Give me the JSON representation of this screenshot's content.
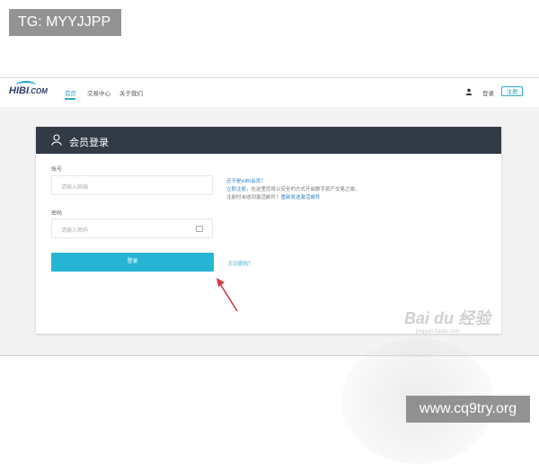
{
  "overlay": {
    "tag": "TG: MYYJJPP",
    "site": "www.cq9try.org"
  },
  "header": {
    "logo": "HIBI",
    "logo_suffix": ".COM",
    "nav": [
      "首页",
      "交易中心",
      "关于我们"
    ],
    "login_link": "登录",
    "register": "注册"
  },
  "card": {
    "title": "会员登录",
    "account_label": "账号",
    "account_placeholder": "请输入邮箱",
    "password_label": "密码",
    "password_placeholder": "请输入密码",
    "login_button": "登录",
    "forgot_link": "忘记密码？",
    "info": {
      "question": "还不是HIBI会员？",
      "register_link": "立即注册",
      "line1": "，在这里您将以安全的方式开启数字资产交易之旅。",
      "line2": "注册时未收到激活邮件？",
      "resend_link": "重新发送激活邮件"
    }
  },
  "watermark": {
    "main": "Bai du 经验",
    "sub": "jingyan.baidu.com"
  },
  "colors": {
    "accent": "#27b5d6",
    "card_header": "#323a45",
    "arrow": "#d33b3b"
  }
}
